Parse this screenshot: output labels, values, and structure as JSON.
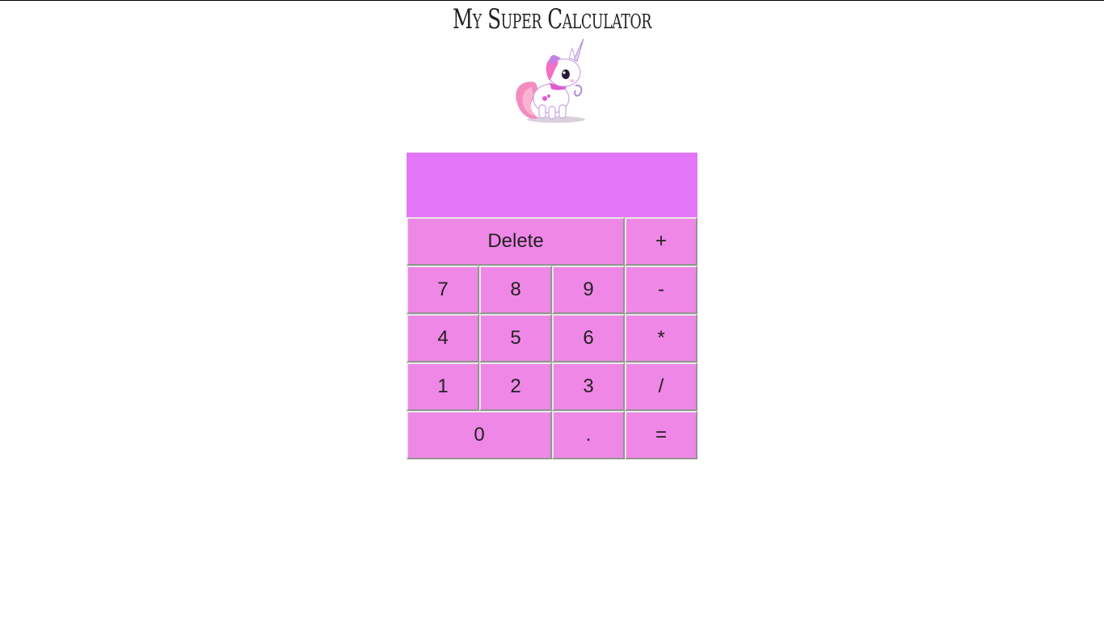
{
  "page": {
    "title": "My Super Calculator"
  },
  "display": {
    "value": ""
  },
  "keys": {
    "delete": "Delete",
    "plus": "+",
    "seven": "7",
    "eight": "8",
    "nine": "9",
    "minus": "-",
    "four": "4",
    "five": "5",
    "six": "6",
    "multiply": "*",
    "one": "1",
    "two": "2",
    "three": "3",
    "divide": "/",
    "zero": "0",
    "dot": ".",
    "equals": "="
  },
  "colors": {
    "display_bg": "#e377f7",
    "key_bg": "#ef87e6"
  },
  "mascot": {
    "icon": "unicorn-icon"
  }
}
